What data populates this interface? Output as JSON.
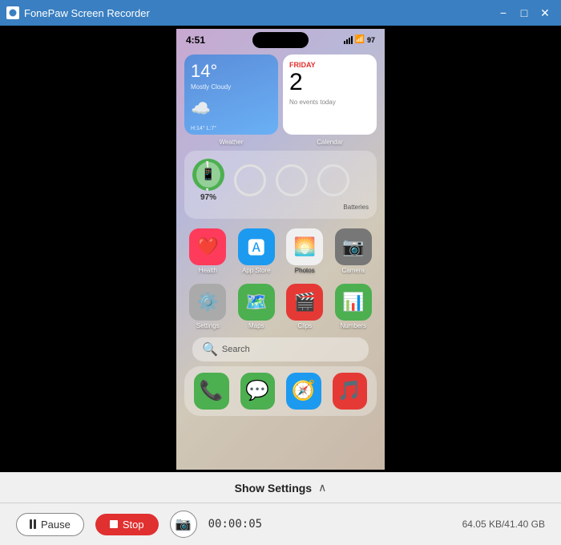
{
  "window": {
    "title": "FonePaw Screen Recorder",
    "minimize_label": "−",
    "maximize_label": "□",
    "close_label": "✕"
  },
  "phone": {
    "status": {
      "time": "4:51",
      "battery_pct": "97"
    },
    "widgets": {
      "weather": {
        "temp": "14°",
        "description": "Mostly Cloudy",
        "range": "H:14° L:7°",
        "label": "Weather"
      },
      "calendar": {
        "day": "FRIDAY",
        "date": "2",
        "events": "No events today",
        "label": "Calendar"
      }
    },
    "battery_widget": {
      "label": "Batteries",
      "percentage": "97%"
    },
    "apps_row1": [
      {
        "name": "Health",
        "emoji": "❤️",
        "bg": "#ff3b5c"
      },
      {
        "name": "App Store",
        "emoji": "🅰",
        "bg": "#1c9aef"
      },
      {
        "name": "Photos",
        "emoji": "🌅",
        "bg": "#f0f0f0"
      },
      {
        "name": "Camera",
        "emoji": "📷",
        "bg": "#888"
      }
    ],
    "apps_row2": [
      {
        "name": "Settings",
        "emoji": "⚙️",
        "bg": "#aaa"
      },
      {
        "name": "Maps",
        "emoji": "🗺️",
        "bg": "#4caf50"
      },
      {
        "name": "Clips",
        "emoji": "🎬",
        "bg": "#e53935"
      },
      {
        "name": "Numbers",
        "emoji": "📊",
        "bg": "#4caf50"
      }
    ],
    "search": {
      "icon": "🔍",
      "placeholder": "Search"
    },
    "dock": [
      {
        "name": "Phone",
        "emoji": "📞",
        "bg": "#4caf50"
      },
      {
        "name": "Messages",
        "emoji": "💬",
        "bg": "#4caf50"
      },
      {
        "name": "Safari",
        "emoji": "🧭",
        "bg": "#1c9aef"
      },
      {
        "name": "Music",
        "emoji": "🎵",
        "bg": "#e53935"
      }
    ]
  },
  "bottom_panel": {
    "show_settings_label": "Show Settings",
    "pause_label": "Pause",
    "stop_label": "Stop",
    "timer": "00:00:05",
    "storage": "64.05 KB/41.40 GB"
  }
}
